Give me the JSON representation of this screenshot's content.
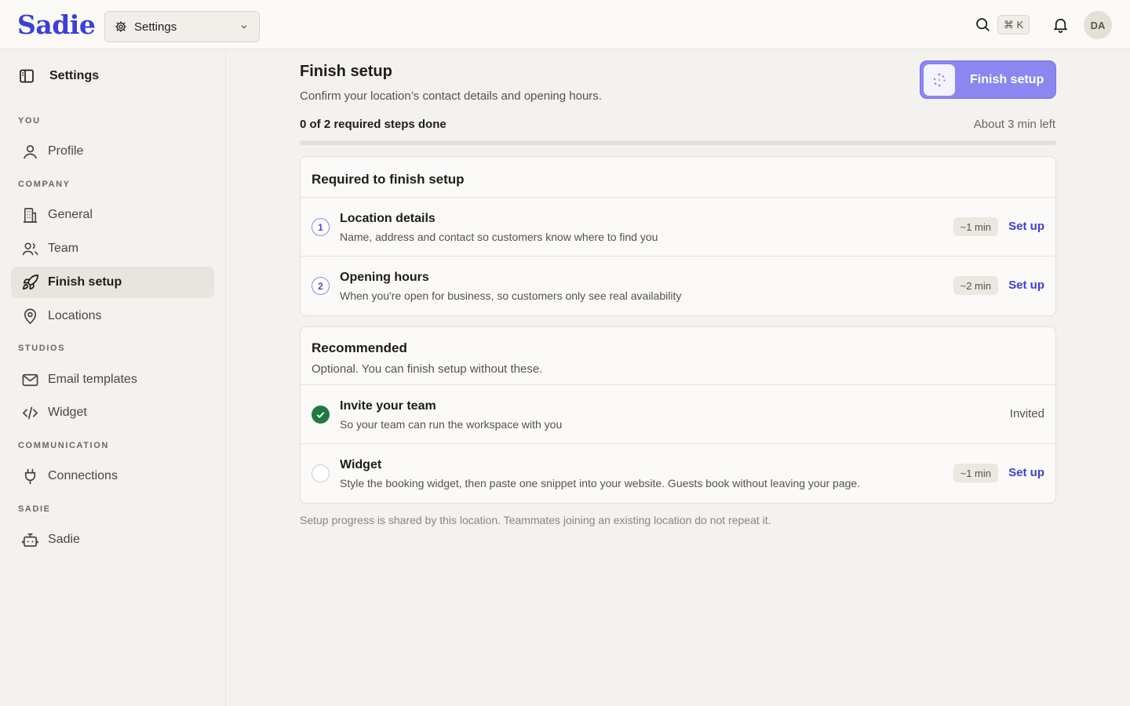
{
  "topbar": {
    "logo": "Sadie",
    "workspace_select": "Settings",
    "shortcut": "⌘ K",
    "avatar_initials": "DA"
  },
  "sidebar": {
    "title": "Settings",
    "sections": {
      "you": "YOU",
      "company": "COMPANY",
      "studios": "STUDIOS",
      "communication": "COMMUNICATION",
      "sadie": "SADIE"
    },
    "items": {
      "profile": "Profile",
      "general": "General",
      "team": "Team",
      "finish_setup": "Finish setup",
      "locations": "Locations",
      "email_templates": "Email templates",
      "widget": "Widget",
      "connections": "Connections",
      "sadie": "Sadie"
    }
  },
  "main": {
    "title": "Finish setup",
    "subtitle": "Confirm your location’s contact details and opening hours.",
    "finish_button": "Finish setup",
    "progress": {
      "label": "0 of 2 required steps done",
      "time_left": "About 3 min left",
      "completed_fraction": 0
    },
    "required": {
      "title": "Required to finish setup",
      "steps": [
        {
          "number": "1",
          "title": "Location details",
          "description": "Name, address and contact so customers know where to find you",
          "time": "~1 min",
          "action": "Set up"
        },
        {
          "number": "2",
          "title": "Opening hours",
          "description": "When you're open for business, so customers only see real availability",
          "time": "~2 min",
          "action": "Set up"
        }
      ]
    },
    "recommended": {
      "title": "Recommended",
      "description": "Optional. You can finish setup without these.",
      "steps": [
        {
          "title": "Invite your team",
          "description": "So your team can run the workspace with you",
          "status": "Invited"
        },
        {
          "title": "Widget",
          "description": "Style the booking widget, then paste one snippet into your website. Guests book without leaving your page.",
          "time": "~1 min",
          "action": "Set up"
        }
      ]
    },
    "footnote": "Setup progress is shared by this location. Teammates joining an existing location do not repeat it."
  },
  "colors": {
    "accent": "#3b3fd8",
    "button": "#8b86f0",
    "success": "#1f7a3f",
    "background": "#f4f2ee"
  }
}
